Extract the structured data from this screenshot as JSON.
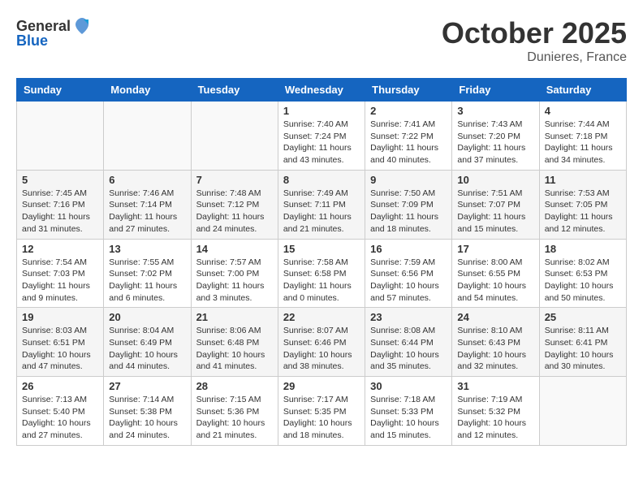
{
  "header": {
    "logo_general": "General",
    "logo_blue": "Blue",
    "month": "October 2025",
    "location": "Dunieres, France"
  },
  "weekdays": [
    "Sunday",
    "Monday",
    "Tuesday",
    "Wednesday",
    "Thursday",
    "Friday",
    "Saturday"
  ],
  "weeks": [
    [
      {
        "day": "",
        "info": ""
      },
      {
        "day": "",
        "info": ""
      },
      {
        "day": "",
        "info": ""
      },
      {
        "day": "1",
        "info": "Sunrise: 7:40 AM\nSunset: 7:24 PM\nDaylight: 11 hours\nand 43 minutes."
      },
      {
        "day": "2",
        "info": "Sunrise: 7:41 AM\nSunset: 7:22 PM\nDaylight: 11 hours\nand 40 minutes."
      },
      {
        "day": "3",
        "info": "Sunrise: 7:43 AM\nSunset: 7:20 PM\nDaylight: 11 hours\nand 37 minutes."
      },
      {
        "day": "4",
        "info": "Sunrise: 7:44 AM\nSunset: 7:18 PM\nDaylight: 11 hours\nand 34 minutes."
      }
    ],
    [
      {
        "day": "5",
        "info": "Sunrise: 7:45 AM\nSunset: 7:16 PM\nDaylight: 11 hours\nand 31 minutes."
      },
      {
        "day": "6",
        "info": "Sunrise: 7:46 AM\nSunset: 7:14 PM\nDaylight: 11 hours\nand 27 minutes."
      },
      {
        "day": "7",
        "info": "Sunrise: 7:48 AM\nSunset: 7:12 PM\nDaylight: 11 hours\nand 24 minutes."
      },
      {
        "day": "8",
        "info": "Sunrise: 7:49 AM\nSunset: 7:11 PM\nDaylight: 11 hours\nand 21 minutes."
      },
      {
        "day": "9",
        "info": "Sunrise: 7:50 AM\nSunset: 7:09 PM\nDaylight: 11 hours\nand 18 minutes."
      },
      {
        "day": "10",
        "info": "Sunrise: 7:51 AM\nSunset: 7:07 PM\nDaylight: 11 hours\nand 15 minutes."
      },
      {
        "day": "11",
        "info": "Sunrise: 7:53 AM\nSunset: 7:05 PM\nDaylight: 11 hours\nand 12 minutes."
      }
    ],
    [
      {
        "day": "12",
        "info": "Sunrise: 7:54 AM\nSunset: 7:03 PM\nDaylight: 11 hours\nand 9 minutes."
      },
      {
        "day": "13",
        "info": "Sunrise: 7:55 AM\nSunset: 7:02 PM\nDaylight: 11 hours\nand 6 minutes."
      },
      {
        "day": "14",
        "info": "Sunrise: 7:57 AM\nSunset: 7:00 PM\nDaylight: 11 hours\nand 3 minutes."
      },
      {
        "day": "15",
        "info": "Sunrise: 7:58 AM\nSunset: 6:58 PM\nDaylight: 11 hours\nand 0 minutes."
      },
      {
        "day": "16",
        "info": "Sunrise: 7:59 AM\nSunset: 6:56 PM\nDaylight: 10 hours\nand 57 minutes."
      },
      {
        "day": "17",
        "info": "Sunrise: 8:00 AM\nSunset: 6:55 PM\nDaylight: 10 hours\nand 54 minutes."
      },
      {
        "day": "18",
        "info": "Sunrise: 8:02 AM\nSunset: 6:53 PM\nDaylight: 10 hours\nand 50 minutes."
      }
    ],
    [
      {
        "day": "19",
        "info": "Sunrise: 8:03 AM\nSunset: 6:51 PM\nDaylight: 10 hours\nand 47 minutes."
      },
      {
        "day": "20",
        "info": "Sunrise: 8:04 AM\nSunset: 6:49 PM\nDaylight: 10 hours\nand 44 minutes."
      },
      {
        "day": "21",
        "info": "Sunrise: 8:06 AM\nSunset: 6:48 PM\nDaylight: 10 hours\nand 41 minutes."
      },
      {
        "day": "22",
        "info": "Sunrise: 8:07 AM\nSunset: 6:46 PM\nDaylight: 10 hours\nand 38 minutes."
      },
      {
        "day": "23",
        "info": "Sunrise: 8:08 AM\nSunset: 6:44 PM\nDaylight: 10 hours\nand 35 minutes."
      },
      {
        "day": "24",
        "info": "Sunrise: 8:10 AM\nSunset: 6:43 PM\nDaylight: 10 hours\nand 32 minutes."
      },
      {
        "day": "25",
        "info": "Sunrise: 8:11 AM\nSunset: 6:41 PM\nDaylight: 10 hours\nand 30 minutes."
      }
    ],
    [
      {
        "day": "26",
        "info": "Sunrise: 7:13 AM\nSunset: 5:40 PM\nDaylight: 10 hours\nand 27 minutes."
      },
      {
        "day": "27",
        "info": "Sunrise: 7:14 AM\nSunset: 5:38 PM\nDaylight: 10 hours\nand 24 minutes."
      },
      {
        "day": "28",
        "info": "Sunrise: 7:15 AM\nSunset: 5:36 PM\nDaylight: 10 hours\nand 21 minutes."
      },
      {
        "day": "29",
        "info": "Sunrise: 7:17 AM\nSunset: 5:35 PM\nDaylight: 10 hours\nand 18 minutes."
      },
      {
        "day": "30",
        "info": "Sunrise: 7:18 AM\nSunset: 5:33 PM\nDaylight: 10 hours\nand 15 minutes."
      },
      {
        "day": "31",
        "info": "Sunrise: 7:19 AM\nSunset: 5:32 PM\nDaylight: 10 hours\nand 12 minutes."
      },
      {
        "day": "",
        "info": ""
      }
    ]
  ]
}
